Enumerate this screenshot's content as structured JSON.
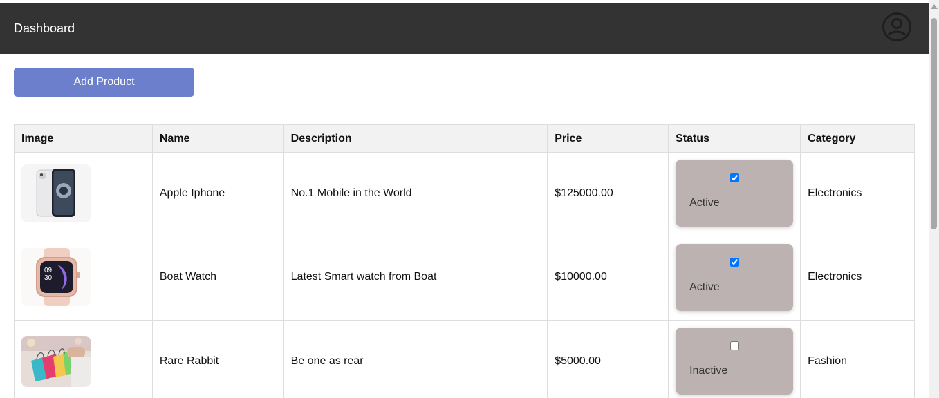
{
  "header": {
    "title": "Dashboard",
    "profile_icon": "account-circle-icon"
  },
  "actions": {
    "add_product_label": "Add Product"
  },
  "table": {
    "columns": [
      "Image",
      "Name",
      "Description",
      "Price",
      "Status",
      "Category"
    ],
    "rows": [
      {
        "image": "apple-iphone-image",
        "name": "Apple Iphone",
        "description": "No.1 Mobile in the World",
        "price": "$125000.00",
        "active": true,
        "status": "Active",
        "category": "Electronics"
      },
      {
        "image": "boat-watch-image",
        "name": "Boat Watch",
        "description": "Latest Smart watch from Boat",
        "price": "$10000.00",
        "active": true,
        "status": "Active",
        "category": "Electronics"
      },
      {
        "image": "shopping-bags-image",
        "name": "Rare Rabbit",
        "description": "Be one as rear",
        "price": "$5000.00",
        "active": false,
        "status": "Inactive",
        "category": "Fashion"
      }
    ]
  },
  "colors": {
    "header_bg": "#333333",
    "button_bg": "#6b7fcc",
    "status_card_bg": "#bcb2b2"
  }
}
